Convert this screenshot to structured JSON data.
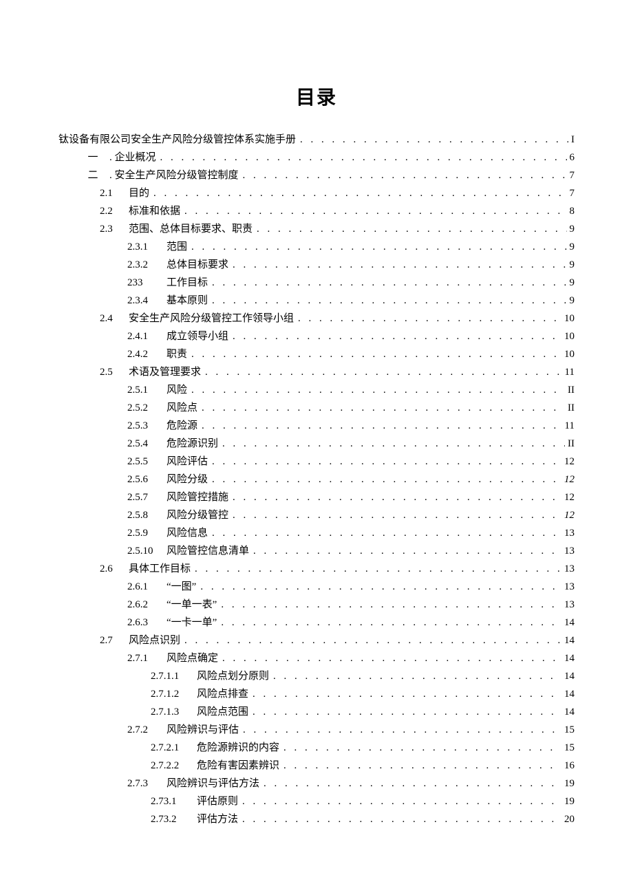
{
  "title": "目录",
  "entries": [
    {
      "level": 0,
      "num": "",
      "text": "钛设备有限公司安全生产风险分级管控体系实施手册",
      "page": "I"
    },
    {
      "level": 1,
      "num": "一",
      "text": ". 企业概况",
      "page": "6"
    },
    {
      "level": 1,
      "num": "二",
      "text": ". 安全生产风险分级管控制度",
      "page": "7"
    },
    {
      "level": 2,
      "num": "2.1",
      "text": "目的",
      "page": "7"
    },
    {
      "level": 2,
      "num": "2.2",
      "text": "标准和依据",
      "page": "8"
    },
    {
      "level": 2,
      "num": "2.3",
      "text": "范围、总体目标要求、职责",
      "page": "9"
    },
    {
      "level": 3,
      "num": "2.3.1",
      "text": "范围",
      "page": "9"
    },
    {
      "level": 3,
      "num": "2.3.2",
      "text": "总体目标要求",
      "page": "9"
    },
    {
      "level": 3,
      "num": "233",
      "text": "工作目标",
      "page": "9"
    },
    {
      "level": 3,
      "num": "2.3.4",
      "text": "基本原则",
      "page": "9"
    },
    {
      "level": 2,
      "num": "2.4",
      "text": "安全生产风险分级管控工作领导小组",
      "page": "10"
    },
    {
      "level": 3,
      "num": "2.4.1",
      "text": "成立领导小组",
      "page": "10"
    },
    {
      "level": 3,
      "num": "2.4.2",
      "text": "职责",
      "page": "10"
    },
    {
      "level": 2,
      "num": "2.5",
      "text": "术语及管理要求",
      "page": "11"
    },
    {
      "level": 3,
      "num": "2.5.1",
      "text": "风险",
      "page": "II"
    },
    {
      "level": 3,
      "num": "2.5.2",
      "text": "风险点",
      "page": "II"
    },
    {
      "level": 3,
      "num": "2.5.3",
      "text": "危险源",
      "page": "11"
    },
    {
      "level": 3,
      "num": "2.5.4",
      "text": "危险源识别",
      "page": "II"
    },
    {
      "level": 3,
      "num": "2.5.5",
      "text": "风险评估",
      "page": "12"
    },
    {
      "level": 3,
      "num": "2.5.6",
      "text": "风险分级",
      "page": "12",
      "italic": true
    },
    {
      "level": 3,
      "num": "2.5.7",
      "text": "风险管控措施",
      "page": "12"
    },
    {
      "level": 3,
      "num": "2.5.8",
      "text": "风险分级管控",
      "page": "12",
      "italic": true
    },
    {
      "level": 3,
      "num": "2.5.9",
      "text": "风险信息",
      "page": "13"
    },
    {
      "level": 3,
      "num": "2.5.10",
      "text": "风险管控信息清单",
      "page": "13"
    },
    {
      "level": 2,
      "num": "2.6",
      "text": "具体工作目标",
      "page": "13"
    },
    {
      "level": 3,
      "num": "2.6.1",
      "text": "“一图”",
      "page": "13"
    },
    {
      "level": 3,
      "num": "2.6.2",
      "text": "“一单一表”",
      "page": "13"
    },
    {
      "level": 3,
      "num": "2.6.3",
      "text": "“一卡一单”",
      "page": "14"
    },
    {
      "level": 2,
      "num": "2.7",
      "text": "风险点识别",
      "page": "14"
    },
    {
      "level": 3,
      "num": "2.7.1",
      "text": "风险点确定",
      "page": "14"
    },
    {
      "level": 4,
      "num": "2.7.1.1",
      "text": "风险点划分原则",
      "page": "14"
    },
    {
      "level": 4,
      "num": "2.7.1.2",
      "text": "风险点排查",
      "page": "14"
    },
    {
      "level": 4,
      "num": "2.7.1.3",
      "text": "风险点范围",
      "page": "14"
    },
    {
      "level": 3,
      "num": "2.7.2",
      "text": "风险辨识与评估",
      "page": "15"
    },
    {
      "level": 4,
      "num": "2.7.2.1",
      "text": "危险源辨识的内容",
      "page": "15"
    },
    {
      "level": 4,
      "num": "2.7.2.2",
      "text": "危险有害因素辨识",
      "page": "16"
    },
    {
      "level": 3,
      "num": "2.7.3",
      "text": "风险辨识与评估方法",
      "page": "19"
    },
    {
      "level": 4,
      "num": "2.73.1",
      "text": "评估原则",
      "page": "19"
    },
    {
      "level": 4,
      "num": "2.73.2",
      "text": "评估方法",
      "page": "20"
    }
  ]
}
